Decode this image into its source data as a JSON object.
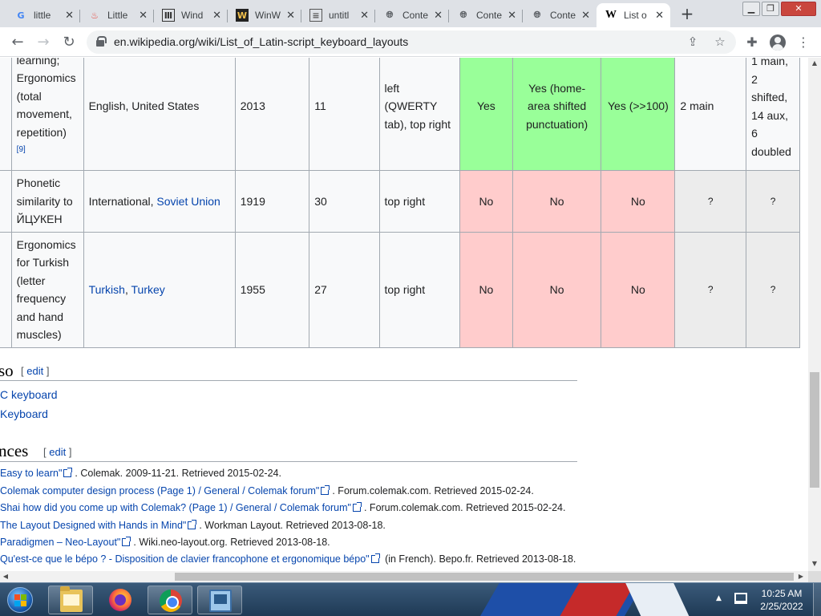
{
  "tabs": [
    {
      "title": "little",
      "icon": "google-icon"
    },
    {
      "title": "Little",
      "icon": "flame-icon"
    },
    {
      "title": "Wind",
      "icon": "wikipedia-book-icon"
    },
    {
      "title": "WinW",
      "icon": "worldwide-w-icon"
    },
    {
      "title": "untitl",
      "icon": "document-icon"
    },
    {
      "title": "Conte",
      "icon": "globe-icon"
    },
    {
      "title": "Conte",
      "icon": "globe-icon"
    },
    {
      "title": "Conte",
      "icon": "globe-icon"
    },
    {
      "title": "List o",
      "icon": "wikipedia-w-icon",
      "active": true
    }
  ],
  "toolbar": {
    "url": "en.wikipedia.org/wiki/List_of_Latin-script_keyboard_layouts"
  },
  "table": {
    "rows": [
      {
        "purpose_lines": [
          "learning;",
          "Ergonomics",
          "(total",
          "movement,",
          "repetition)"
        ],
        "purpose_ref": "[9]",
        "language_text": "English, United States",
        "year": "2013",
        "keys": "11",
        "shortcut": "left (QWERTY tab), top right",
        "col1": "Yes",
        "col2": "Yes (home-area shifted punctuation)",
        "col3": "Yes (>>100)",
        "col4": "2 main",
        "col5": "1 main, 2 shifted, 14 aux, 6 doubled"
      },
      {
        "purpose_lines": [
          "Phonetic",
          "similarity to",
          "ЙЦУКЕН"
        ],
        "language_prefix": "International, ",
        "language_link": "Soviet Union",
        "year": "1919",
        "keys": "30",
        "shortcut": "top right",
        "col1": "No",
        "col2": "No",
        "col3": "No",
        "col4": "?",
        "col5": "?"
      },
      {
        "purpose_lines": [
          "Ergonomics",
          "for Turkish",
          "(letter",
          "frequency",
          "and hand",
          "muscles)"
        ],
        "language_link1": "Turkish",
        "language_sep": ", ",
        "language_link2": "Turkey",
        "year": "1955",
        "keys": "27",
        "shortcut": "top right",
        "col1": "No",
        "col2": "No",
        "col3": "No",
        "col4": "?",
        "col5": "?"
      }
    ]
  },
  "see_also": {
    "heading": "so",
    "edit_label": "edit",
    "items": [
      "C keyboard",
      "Keyboard"
    ]
  },
  "references": {
    "heading": "nces",
    "edit_label": "edit",
    "items": [
      {
        "link": "Easy to learn\"",
        "rest": ". Colemak. 2009-11-21. Retrieved 2015-02-24."
      },
      {
        "link": "Colemak computer design process (Page 1) / General / Colemak forum\"",
        "rest": ". Forum.colemak.com. Retrieved 2015-02-24."
      },
      {
        "link": "Shai how did you come up with Colemak? (Page 1) / General / Colemak forum\"",
        "rest": ". Forum.colemak.com. Retrieved 2015-02-24."
      },
      {
        "link": "The Layout Designed with Hands in Mind\"",
        "rest": ". Workman Layout. Retrieved 2013-08-18."
      },
      {
        "link": "Paradigmen – Neo-Layout\"",
        "rest": ". Wiki.neo-layout.org. Retrieved 2013-08-18."
      },
      {
        "link": "Qu'est-ce que le bépo ? - Disposition de clavier francophone et ergonomique bépo\"",
        "rest": " (in French). Bepo.fr. Retrieved 2013-08-18."
      }
    ]
  },
  "taskbar": {
    "time": "10:25 AM",
    "date": "2/25/2022"
  },
  "colors": {
    "yes_cell": "#99ff99",
    "no_cell": "#ffcccc",
    "unknown_cell": "#ececec",
    "link": "#0645ad"
  }
}
